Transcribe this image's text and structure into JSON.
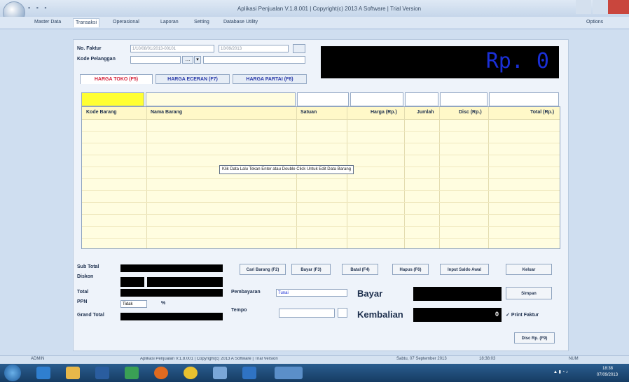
{
  "window": {
    "title": "Aplikasi Penjualan V.1.8.001 | Copyright(c) 2013 A Software | Trial Version",
    "help_label": "Options"
  },
  "menu": [
    "Master Data",
    "Transaksi",
    "Operasional",
    "Laporan",
    "Setting",
    "Database Utility"
  ],
  "form": {
    "no_faktur_label": "No. Faktur",
    "no_faktur_value": "1/10/08/01/2013-00101",
    "date_value": "10/09/2013",
    "kode_pelanggan_label": "Kode Pelanggan"
  },
  "display": {
    "amount": "Rp. 0"
  },
  "tabs": [
    "HARGA TOKO (F5)",
    "HARGA ECERAN (F7)",
    "HARGA PARTAI (F8)"
  ],
  "grid": {
    "columns": [
      "Kode Barang",
      "Nama Barang",
      "Satuan",
      "Harga (Rp.)",
      "Jumlah",
      "Disc (Rp.)",
      "Total (Rp.)"
    ],
    "hint": "Klik Data Lalu Tekan Enter atau Double Click Untuk Edit Data Barang"
  },
  "summary": {
    "sub_total_label": "Sub Total",
    "diskon_label": "Diskon",
    "total_label": "Total",
    "ppn_label": "PPN",
    "ppn_option": "Tidak",
    "percent": "%",
    "grand_total_label": "Grand Total"
  },
  "actions": [
    "Cari Barang (F2)",
    "Bayar (F3)",
    "Batal (F4)",
    "Hapus (F6)",
    "Input Saldo Awal",
    "Keluar"
  ],
  "payment": {
    "pembayaran_label": "Pembayaran",
    "pembayaran_value": "Tunai",
    "tempo_label": "Tempo",
    "bayar_label": "Bayar",
    "kembalian_label": "Kembalian",
    "kembalian_value": "0",
    "simpan_label": "Simpan",
    "print_label": "Print Faktur",
    "disc_label": "Disc Rp. (F9)"
  },
  "status": {
    "left": "ADMIN",
    "center": "Aplikasi Penjualan V.1.8.001 | Copyright(c) 2013 A Software | Trial Version",
    "date": "Sabtu, 07 September 2013",
    "time_left": "18:38:03",
    "right": "NUM"
  },
  "taskbar": {
    "clock": "18:38",
    "date": "07/09/2013"
  }
}
